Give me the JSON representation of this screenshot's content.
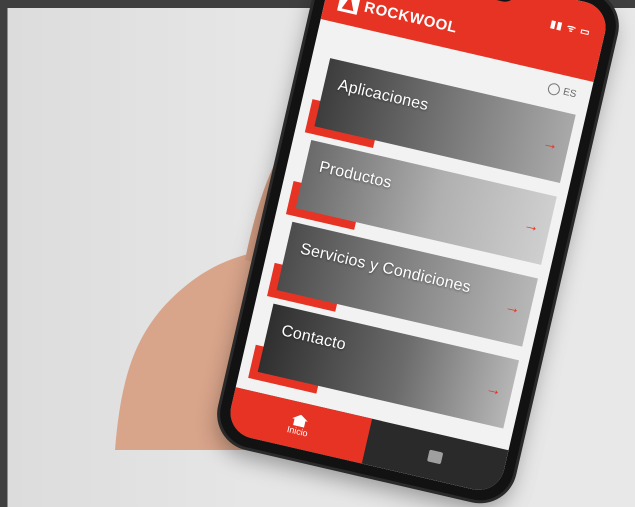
{
  "app": {
    "brand": "ROCKWOOL",
    "status_bar": "▮▮ ᯤ ▭",
    "language": "ES"
  },
  "menu": {
    "items": [
      {
        "label": "Aplicaciones"
      },
      {
        "label": "Productos"
      },
      {
        "label": "Servicios y Condiciones"
      },
      {
        "label": "Contacto"
      }
    ]
  },
  "tabs": [
    {
      "label": "Inicio",
      "icon": "home-icon",
      "active": true
    },
    {
      "label": "",
      "icon": "gallery-icon",
      "active": false
    }
  ],
  "colors": {
    "brand_red": "#e63323",
    "bar_dark": "#2a2a2a",
    "background": "#e6e6e6"
  }
}
